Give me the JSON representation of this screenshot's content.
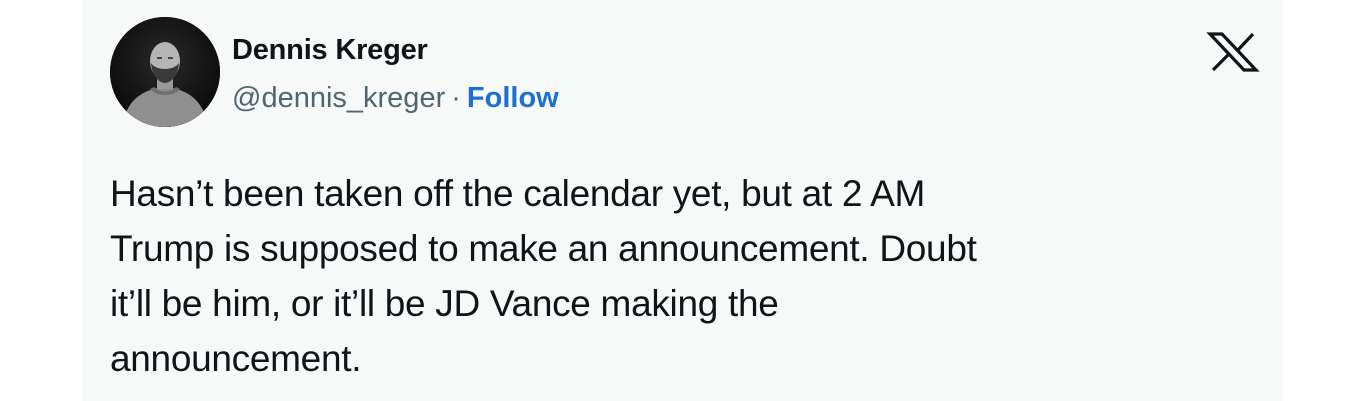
{
  "author": {
    "name": "Dennis Kreger",
    "handle": "@dennis_kreger",
    "separator": "·",
    "follow_label": "Follow"
  },
  "brand_icon": "x-logo-icon",
  "tweet": {
    "lines": [
      "Hasn’t been taken off the calendar yet, but at 2 AM",
      "Trump is supposed to make an announcement. Doubt",
      "it’ll be him, or it’ll be JD Vance making the",
      "announcement."
    ]
  },
  "colors": {
    "card_background": "#f7f9f9",
    "text": "#0f1419",
    "secondary_text": "#536471",
    "follow_link": "#1d6fd1"
  }
}
